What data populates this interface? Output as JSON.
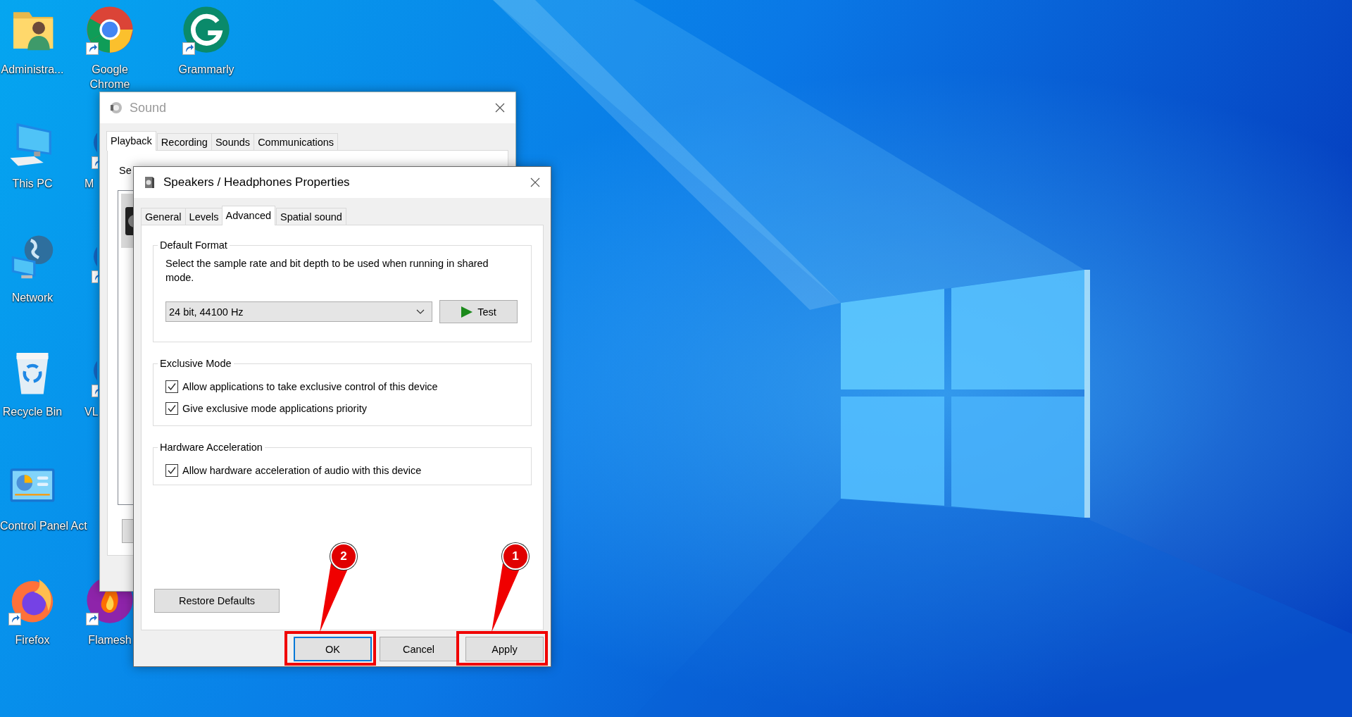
{
  "desktop": {
    "icons": [
      {
        "label": "Administra...",
        "kind": "user-folder",
        "shortcut": false
      },
      {
        "label": "This PC",
        "kind": "computer",
        "shortcut": false
      },
      {
        "label": "Network",
        "kind": "network",
        "shortcut": false
      },
      {
        "label": "Recycle Bin",
        "kind": "recycle-bin",
        "shortcut": false
      },
      {
        "label": "Control Panel Act",
        "kind": "control-panel",
        "shortcut": false
      },
      {
        "label": "Firefox",
        "kind": "firefox",
        "shortcut": true
      },
      {
        "label": "Google Chrome",
        "kind": "chrome",
        "shortcut": true
      },
      {
        "label": "M",
        "kind": "partial",
        "shortcut": true
      },
      {
        "kind": "partial",
        "shortcut": true
      },
      {
        "label": "VL",
        "kind": "partial",
        "shortcut": true
      },
      {
        "kind": "empty"
      },
      {
        "label": "Flamesh",
        "kind": "flame",
        "shortcut": true
      },
      {
        "label": "Grammarly",
        "kind": "grammarly",
        "shortcut": true
      }
    ]
  },
  "sound_window": {
    "title": "Sound",
    "tabs": [
      {
        "label": "Playback",
        "selected": true
      },
      {
        "label": "Recording",
        "selected": false
      },
      {
        "label": "Sounds",
        "selected": false
      },
      {
        "label": "Communications",
        "selected": false
      }
    ],
    "description": "Se",
    "device_list": {
      "items": [
        {
          "selected": true
        }
      ],
      "button_below": true
    }
  },
  "properties_dialog": {
    "title": "Speakers / Headphones Properties",
    "tabs": [
      {
        "label": "General",
        "selected": false
      },
      {
        "label": "Levels",
        "selected": false
      },
      {
        "label": "Advanced",
        "selected": true
      },
      {
        "label": "Spatial sound",
        "selected": false
      }
    ],
    "default_format": {
      "title": "Default Format",
      "description": "Select the sample rate and bit depth to be used when running in shared mode.",
      "format": "24 bit, 44100 Hz",
      "test_button": "Test"
    },
    "exclusive_mode": {
      "title": "Exclusive Mode",
      "options": [
        {
          "label": "Allow applications to take exclusive control of this device",
          "checked": true
        },
        {
          "label": "Give exclusive mode applications priority",
          "checked": true
        }
      ]
    },
    "hardware_acceleration": {
      "title": "Hardware Acceleration",
      "options": [
        {
          "label": "Allow hardware acceleration of audio with this device",
          "checked": true
        }
      ]
    },
    "restore_button": "Restore Defaults",
    "buttons": [
      {
        "label": "OK",
        "focused": true,
        "annotation": "2"
      },
      {
        "label": "Cancel",
        "focused": false
      },
      {
        "label": "Apply",
        "focused": false,
        "annotation": "1"
      }
    ]
  }
}
